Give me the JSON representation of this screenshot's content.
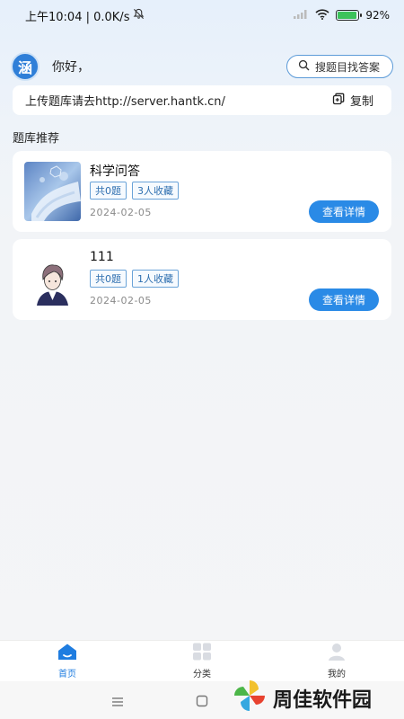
{
  "status_bar": {
    "time_speed": "上午10:04 | 0.0K/s",
    "battery_percent": "92%",
    "battery_level": 0.92
  },
  "header": {
    "logo_char": "涵",
    "greeting": "你好，",
    "search_label": "搜题目找答案"
  },
  "upload": {
    "text": "上传题库请去http://server.hantk.cn/",
    "copy_label": "复制"
  },
  "section_title": "题库推荐",
  "cards": [
    {
      "title": "科学问答",
      "tag_count": "共0题",
      "tag_fav": "3人收藏",
      "date": "2024-02-05",
      "button": "查看详情"
    },
    {
      "title": "111",
      "tag_count": "共0题",
      "tag_fav": "1人收藏",
      "date": "2024-02-05",
      "button": "查看详情"
    }
  ],
  "tabbar": {
    "home": "首页",
    "category": "分类",
    "mine": "我的"
  },
  "watermark": "周佳软件园",
  "colors": {
    "accent": "#2a8ae6",
    "tag_border": "#6aa3d8"
  }
}
